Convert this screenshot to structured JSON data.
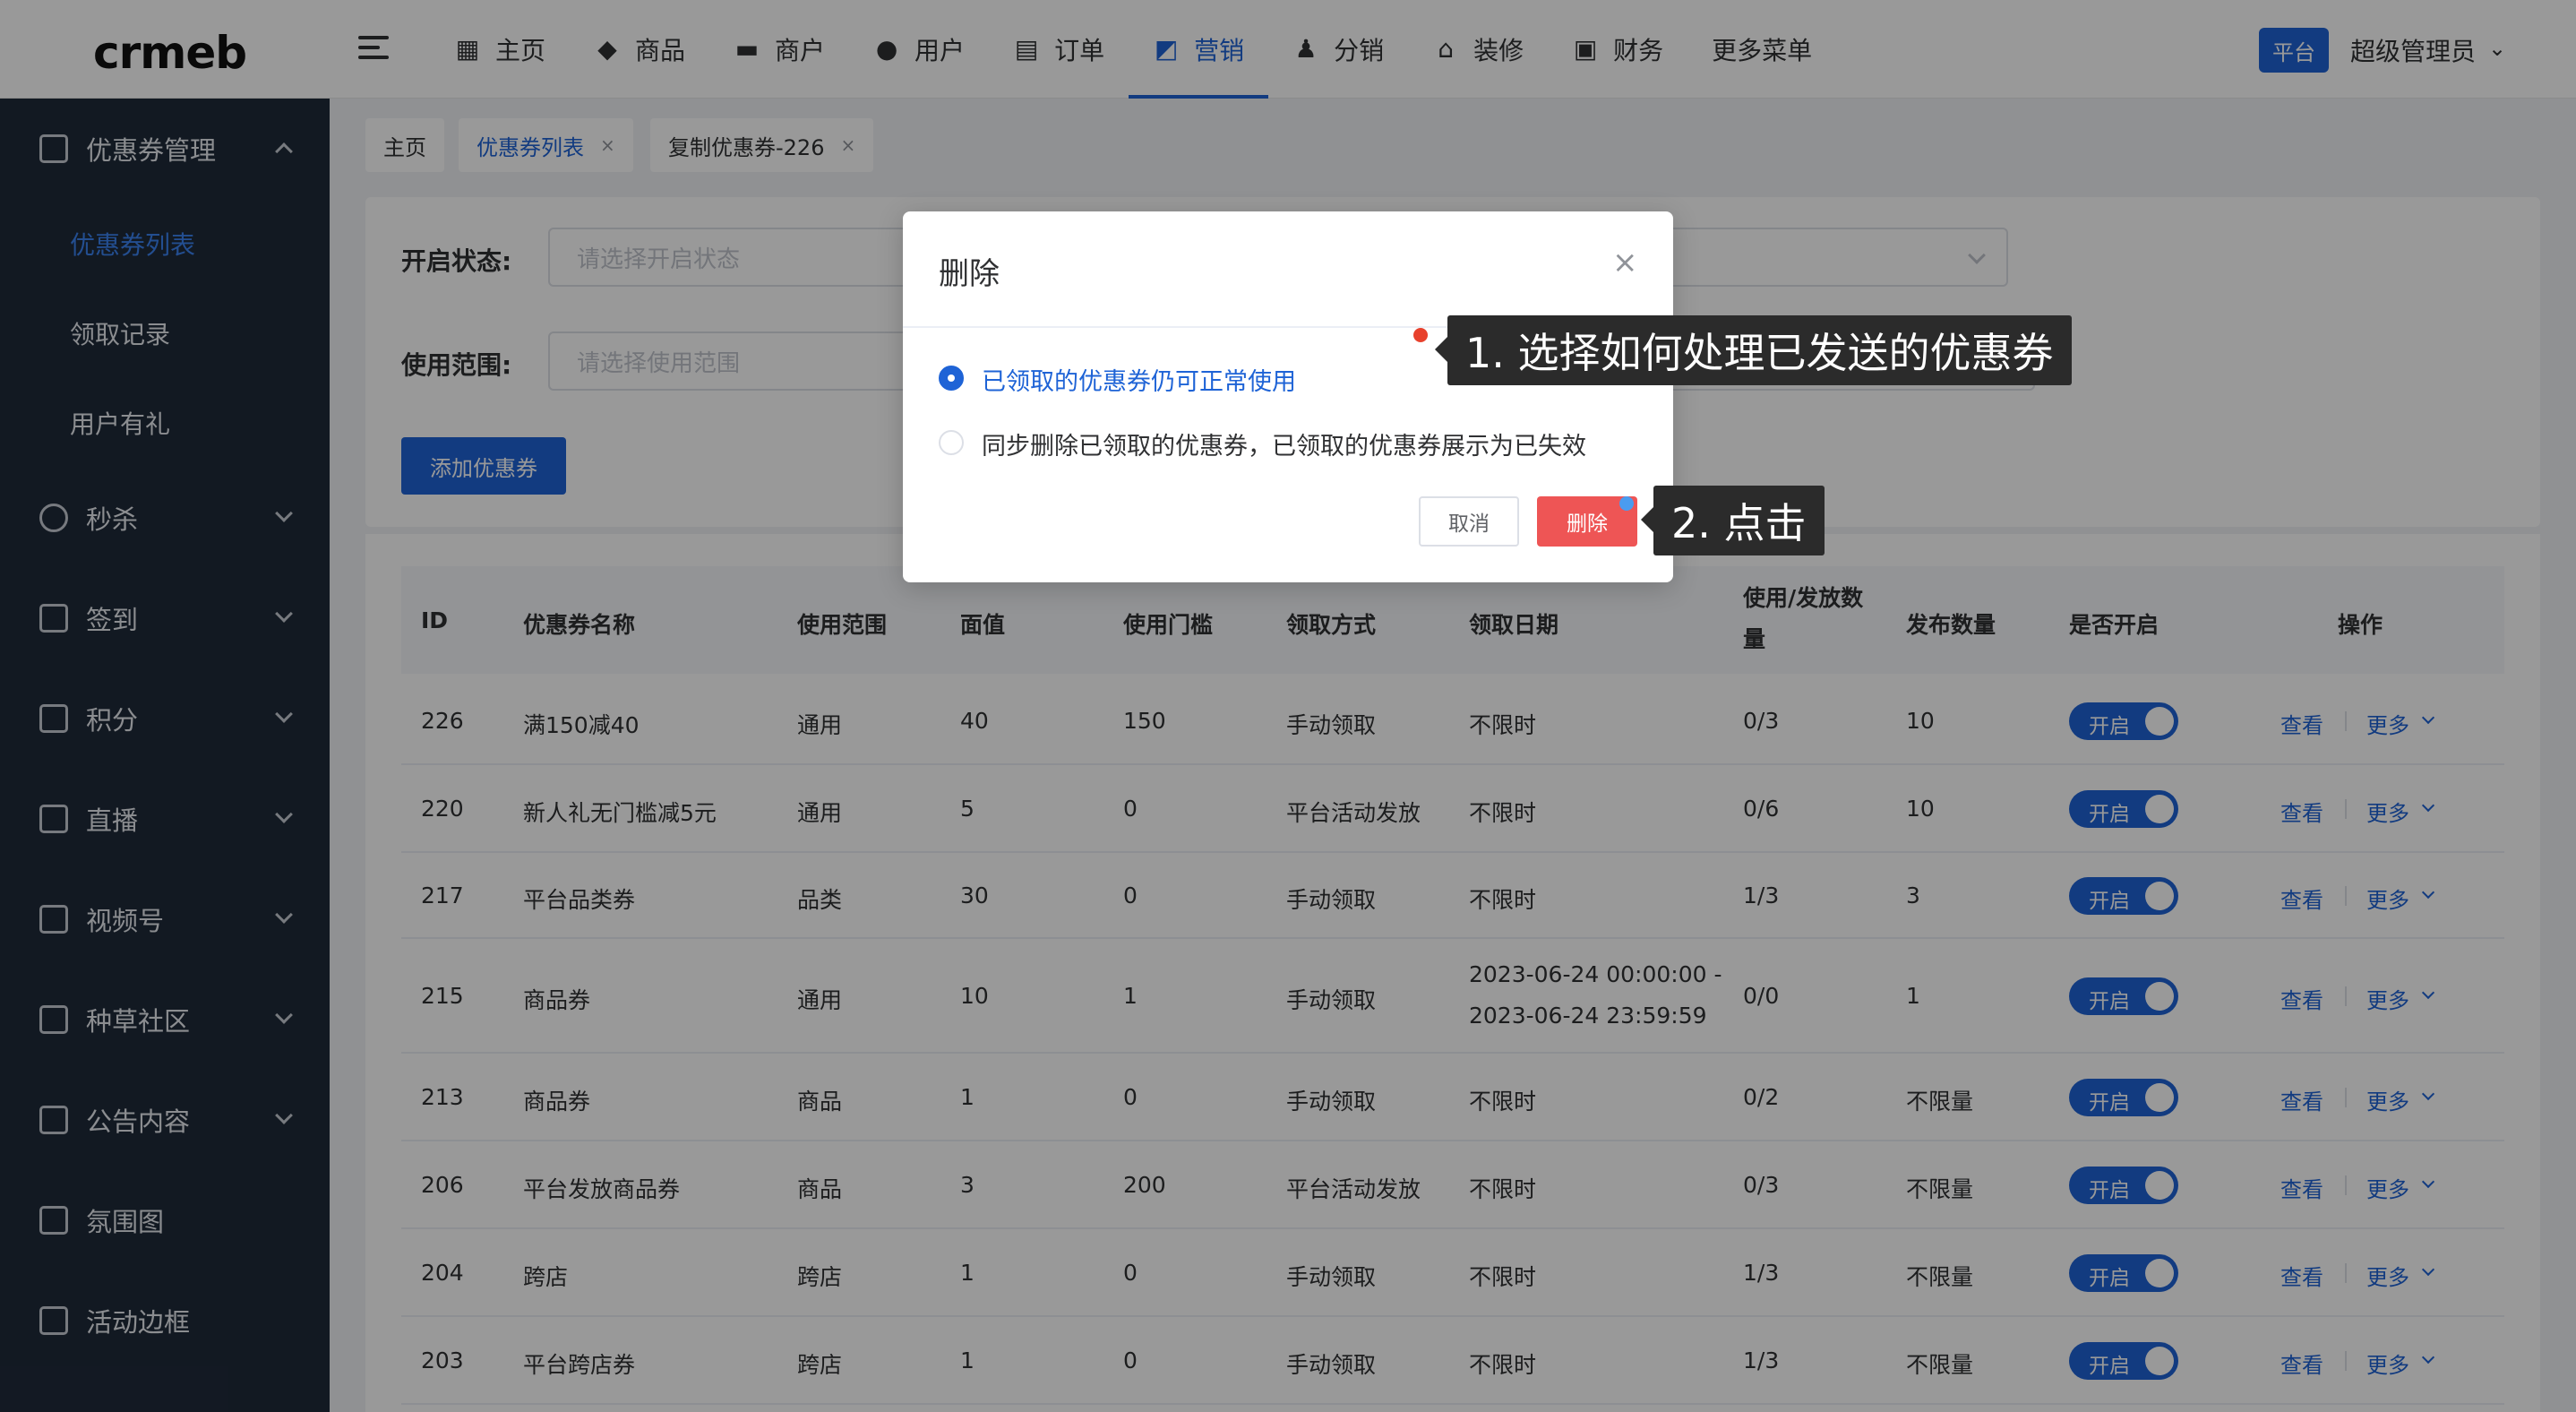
{
  "header": {
    "logo": "crmeb",
    "nav": [
      {
        "label": "主页",
        "icon": "grid-icon",
        "glyph": "▦"
      },
      {
        "label": "商品",
        "icon": "bag-icon",
        "glyph": "◆"
      },
      {
        "label": "商户",
        "icon": "store-icon",
        "glyph": "▬"
      },
      {
        "label": "用户",
        "icon": "user-icon",
        "glyph": "●"
      },
      {
        "label": "订单",
        "icon": "clipboard-icon",
        "glyph": "▤"
      },
      {
        "label": "营销",
        "icon": "chart-icon",
        "glyph": "◩",
        "active": true
      },
      {
        "label": "分销",
        "icon": "distribution-icon",
        "glyph": "♟"
      },
      {
        "label": "装修",
        "icon": "home-icon",
        "glyph": "⌂"
      },
      {
        "label": "财务",
        "icon": "wallet-icon",
        "glyph": "▣"
      },
      {
        "label": "更多菜单",
        "icon": "",
        "glyph": ""
      }
    ],
    "platform_badge": "平台",
    "admin_name": "超级管理员"
  },
  "sidebar": {
    "groups": [
      {
        "label": "优惠券管理",
        "icon": "coupon-icon",
        "expanded": true
      },
      {
        "label": "秒杀",
        "icon": "pause-circle-icon"
      },
      {
        "label": "签到",
        "icon": "trophy-icon"
      },
      {
        "label": "积分",
        "icon": "trophy-icon"
      },
      {
        "label": "直播",
        "icon": "tablet-icon"
      },
      {
        "label": "视频号",
        "icon": "video-icon"
      },
      {
        "label": "种草社区",
        "icon": "grid-icon"
      },
      {
        "label": "公告内容",
        "icon": "notice-icon"
      },
      {
        "label": "氛围图",
        "icon": "cup-icon"
      },
      {
        "label": "活动边框",
        "icon": "frame-icon"
      }
    ],
    "sub_items": [
      {
        "label": "优惠券列表",
        "active": true
      },
      {
        "label": "领取记录"
      },
      {
        "label": "用户有礼"
      }
    ]
  },
  "tags": [
    {
      "label": "主页"
    },
    {
      "label": "优惠券列表",
      "active": true
    },
    {
      "label": "复制优惠券-226"
    }
  ],
  "filters": {
    "status_label": "开启状态:",
    "status_placeholder": "请选择开启状态",
    "scope_label": "使用范围:",
    "scope_placeholder": "请选择使用范围",
    "add_button": "添加优惠券"
  },
  "table": {
    "headers": [
      "ID",
      "优惠券名称",
      "使用范围",
      "面值",
      "使用门槛",
      "领取方式",
      "领取日期",
      "使用/发放数",
      "量",
      "发布数量",
      "是否开启",
      "操作"
    ],
    "rows": [
      {
        "id": "226",
        "name": "满150减40",
        "scope": "通用",
        "value": "40",
        "threshold": "150",
        "method": "手动领取",
        "date": "不限时",
        "date2": "",
        "used": "0/3",
        "issued": "10",
        "enabled": "开启"
      },
      {
        "id": "220",
        "name": "新人礼无门槛减5元",
        "scope": "通用",
        "value": "5",
        "threshold": "0",
        "method": "平台活动发放",
        "date": "不限时",
        "date2": "",
        "used": "0/6",
        "issued": "10",
        "enabled": "开启"
      },
      {
        "id": "217",
        "name": "平台品类券",
        "scope": "品类",
        "value": "30",
        "threshold": "0",
        "method": "手动领取",
        "date": "不限时",
        "date2": "",
        "used": "1/3",
        "issued": "3",
        "enabled": "开启"
      },
      {
        "id": "215",
        "name": "商品券",
        "scope": "通用",
        "value": "10",
        "threshold": "1",
        "method": "手动领取",
        "date": "2023-06-24 00:00:00 -",
        "date2": "2023-06-24 23:59:59",
        "used": "0/0",
        "issued": "1",
        "enabled": "开启"
      },
      {
        "id": "213",
        "name": "商品券",
        "scope": "商品",
        "value": "1",
        "threshold": "0",
        "method": "手动领取",
        "date": "不限时",
        "date2": "",
        "used": "0/2",
        "issued": "不限量",
        "enabled": "开启"
      },
      {
        "id": "206",
        "name": "平台发放商品券",
        "scope": "商品",
        "value": "3",
        "threshold": "200",
        "method": "平台活动发放",
        "date": "不限时",
        "date2": "",
        "used": "0/3",
        "issued": "不限量",
        "enabled": "开启"
      },
      {
        "id": "204",
        "name": "跨店",
        "scope": "跨店",
        "value": "1",
        "threshold": "0",
        "method": "手动领取",
        "date": "不限时",
        "date2": "",
        "used": "1/3",
        "issued": "不限量",
        "enabled": "开启"
      },
      {
        "id": "203",
        "name": "平台跨店券",
        "scope": "跨店",
        "value": "1",
        "threshold": "0",
        "method": "手动领取",
        "date": "不限时",
        "date2": "",
        "used": "1/3",
        "issued": "不限量",
        "enabled": "开启"
      }
    ],
    "op_view": "查看",
    "op_more": "更多"
  },
  "dialog": {
    "title": "删除",
    "close": "×",
    "option1": "已领取的优惠券仍可正常使用",
    "option2": "同步删除已领取的优惠券，已领取的优惠券展示为已失效",
    "cancel": "取消",
    "delete": "删除"
  },
  "annotations": {
    "step1": "1. 选择如何处理已发送的优惠券",
    "step2": "2. 点击"
  },
  "colors": {
    "primary": "#1e63d6",
    "danger": "#ee5555",
    "sidebar_bg": "#1f2a3a"
  }
}
